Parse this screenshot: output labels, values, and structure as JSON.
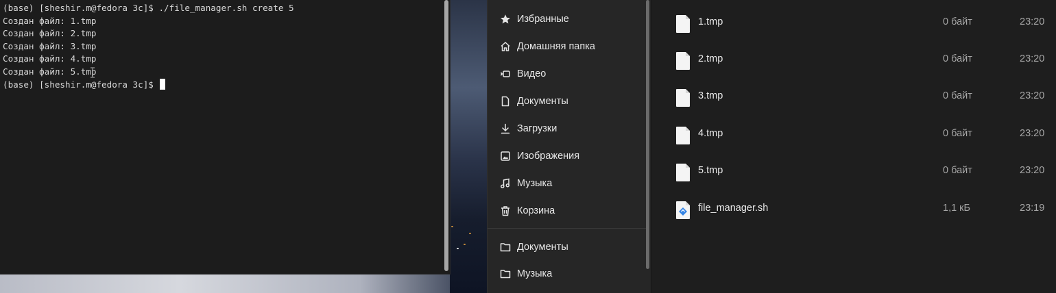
{
  "terminal": {
    "lines": [
      "(base) [sheshir.m@fedora 3c]$ ./file_manager.sh create 5",
      "Создан файл: 1.tmp",
      "Создан файл: 2.tmp",
      "Создан файл: 3.tmp",
      "Создан файл: 4.tmp",
      "Создан файл: 5.tmp"
    ],
    "prompt": "(base) [sheshir.m@fedora 3c]$ "
  },
  "sidebar": {
    "items": [
      {
        "label": "Избранные",
        "icon": "star-icon"
      },
      {
        "label": "Домашняя папка",
        "icon": "home-icon"
      },
      {
        "label": "Видео",
        "icon": "video-icon"
      },
      {
        "label": "Документы",
        "icon": "document-icon"
      },
      {
        "label": "Загрузки",
        "icon": "download-icon"
      },
      {
        "label": "Изображения",
        "icon": "image-icon"
      },
      {
        "label": "Музыка",
        "icon": "music-icon"
      },
      {
        "label": "Корзина",
        "icon": "trash-icon"
      }
    ],
    "bookmarks": [
      {
        "label": "Документы",
        "icon": "folder-icon"
      },
      {
        "label": "Музыка",
        "icon": "folder-icon"
      }
    ]
  },
  "files": [
    {
      "name": "1.tmp",
      "size": "0 байт",
      "time": "23:20",
      "icon": "text-file-icon"
    },
    {
      "name": "2.tmp",
      "size": "0 байт",
      "time": "23:20",
      "icon": "text-file-icon"
    },
    {
      "name": "3.tmp",
      "size": "0 байт",
      "time": "23:20",
      "icon": "text-file-icon"
    },
    {
      "name": "4.tmp",
      "size": "0 байт",
      "time": "23:20",
      "icon": "text-file-icon"
    },
    {
      "name": "5.tmp",
      "size": "0 байт",
      "time": "23:20",
      "icon": "text-file-icon"
    },
    {
      "name": "file_manager.sh",
      "size": "1,1 кБ",
      "time": "23:19",
      "icon": "script-file-icon"
    }
  ],
  "colors": {
    "terminal_bg": "#1c1c1c",
    "sidebar_bg": "#262626",
    "list_bg": "#1e1e1e",
    "script_accent": "#3584e4"
  }
}
